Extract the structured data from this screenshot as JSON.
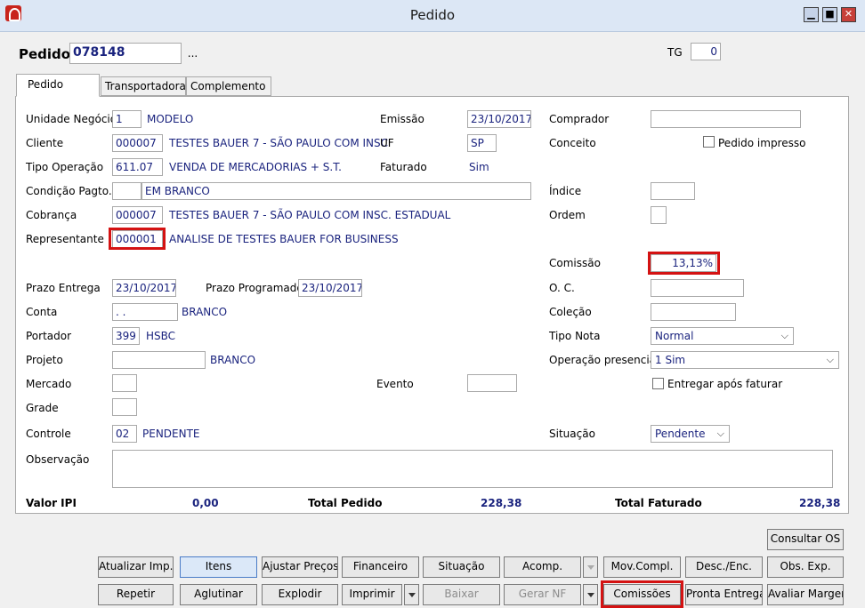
{
  "window": {
    "title": "Pedido"
  },
  "header": {
    "pedido_label": "Pedido",
    "pedido_value": "078148",
    "browse_label": "...",
    "tg_label": "TG",
    "tg_value": "0"
  },
  "tabs": [
    "Pedido",
    "Transportadora",
    "Complemento"
  ],
  "form": {
    "unidade_label": "Unidade Negócio",
    "unidade_code": "1",
    "unidade_name": "MODELO",
    "emissao_label": "Emissão",
    "emissao_value": "23/10/2017",
    "comprador_label": "Comprador",
    "comprador_value": "",
    "cliente_label": "Cliente",
    "cliente_code": "000007",
    "cliente_name": "TESTES BAUER 7 - SÃO PAULO COM INSC",
    "uf_label": "UF",
    "uf_value": "SP",
    "conceito_label": "Conceito",
    "pedido_impresso_label": "Pedido impresso",
    "tipo_op_label": "Tipo Operação",
    "tipo_op_code": "611.07",
    "tipo_op_name": "VENDA DE MERCADORIAS + S.T.",
    "faturado_label": "Faturado",
    "faturado_value": "Sim",
    "condicao_label": "Condição Pagto.",
    "condicao_code": "",
    "condicao_name": "EM BRANCO",
    "indice_label": "Índice",
    "cobranca_label": "Cobrança",
    "cobranca_code": "000007",
    "cobranca_name": "TESTES BAUER 7 - SÃO PAULO COM INSC. ESTADUAL",
    "ordem_label": "Ordem",
    "representante_label": "Representante",
    "representante_code": "000001",
    "representante_name": "ANALISE DE TESTES BAUER FOR BUSINESS",
    "comissao_label": "Comissão",
    "comissao_value": "13,13%",
    "prazo_entrega_label": "Prazo Entrega",
    "prazo_entrega_value": "23/10/2017",
    "prazo_prog_label": "Prazo Programado",
    "prazo_prog_value": "23/10/2017",
    "oc_label": "O. C.",
    "conta_label": "Conta",
    "conta_value": ". .",
    "conta_name": "BRANCO",
    "colecao_label": "Coleção",
    "portador_label": "Portador",
    "portador_code": "399",
    "portador_name": "HSBC",
    "tipo_nota_label": "Tipo Nota",
    "tipo_nota_value": "Normal",
    "projeto_label": "Projeto",
    "projeto_name": "BRANCO",
    "op_presencial_label": "Operação presencial",
    "op_presencial_value": "1 Sim",
    "mercado_label": "Mercado",
    "evento_label": "Evento",
    "entregar_label": "Entregar após faturar",
    "grade_label": "Grade",
    "controle_label": "Controle",
    "controle_code": "02",
    "controle_name": "PENDENTE",
    "situacao_label": "Situação",
    "situacao_value": "Pendente",
    "observacao_label": "Observação"
  },
  "totals": {
    "ipi_label": "Valor IPI",
    "ipi_value": "0,00",
    "pedido_label": "Total Pedido",
    "pedido_value": "228,38",
    "faturado_label": "Total Faturado",
    "faturado_value": "228,38"
  },
  "buttons": {
    "consultar_os": "Consultar OS",
    "atualizar_imp": "Atualizar Imp.",
    "itens": "Itens",
    "ajustar_precos": "Ajustar Preços",
    "financeiro": "Financeiro",
    "situacao": "Situação",
    "acomp": "Acomp.",
    "mov_compl": "Mov.Compl.",
    "desc_enc": "Desc./Enc.",
    "obs_exp": "Obs. Exp.",
    "repetir": "Repetir",
    "aglutinar": "Aglutinar",
    "explodir": "Explodir",
    "imprimir": "Imprimir",
    "baixar": "Baixar",
    "gerar_nf": "Gerar NF",
    "comissoes": "Comissões",
    "pronta_entrega": "Pronta Entrega",
    "avaliar_margem": "Avaliar Margem"
  },
  "colors": {
    "value_text": "#1a237e",
    "highlight": "#d41212",
    "titlebar": "#dce7f5"
  }
}
